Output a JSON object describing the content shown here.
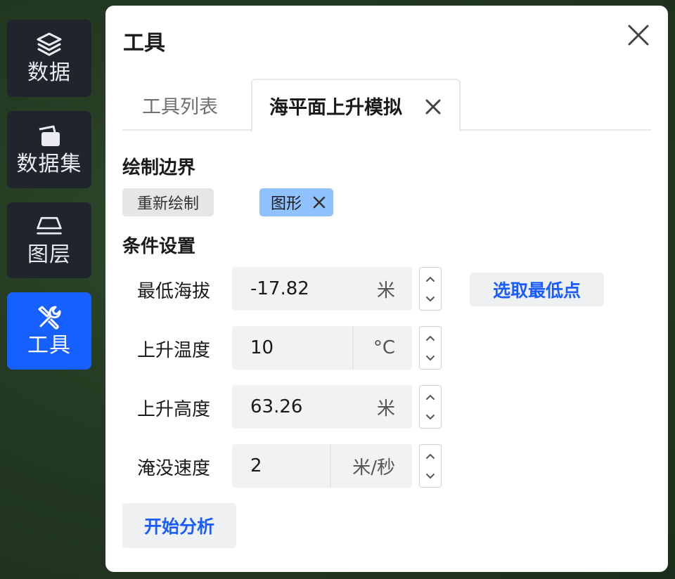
{
  "sidebar": {
    "items": [
      {
        "label": "数据",
        "icon": "layers-icon",
        "active": false
      },
      {
        "label": "数据集",
        "icon": "cards-icon",
        "active": false
      },
      {
        "label": "图层",
        "icon": "layer-plane-icon",
        "active": false
      },
      {
        "label": "工具",
        "icon": "tools-icon",
        "active": true
      }
    ]
  },
  "panel": {
    "title": "工具",
    "tabs": [
      {
        "label": "工具列表"
      },
      {
        "label": "海平面上升模拟"
      }
    ],
    "boundary": {
      "title": "绘制边界",
      "redraw_label": "重新绘制",
      "shape_label": "图形"
    },
    "conditions": {
      "title": "条件设置",
      "fields": [
        {
          "label": "最低海拔",
          "value": "-17.82",
          "unit": "米"
        },
        {
          "label": "上升温度",
          "value": "10",
          "unit": "°C"
        },
        {
          "label": "上升高度",
          "value": "63.26",
          "unit": "米"
        },
        {
          "label": "淹没速度",
          "value": "2",
          "unit": "米/秒"
        }
      ],
      "pick_lowest_label": "选取最低点"
    },
    "start_label": "开始分析"
  },
  "colors": {
    "active_nav": "#1660ff",
    "nav_bg": "#20242c",
    "accent_text": "#1a5cff",
    "chip_selected": "#8fc2ff"
  }
}
